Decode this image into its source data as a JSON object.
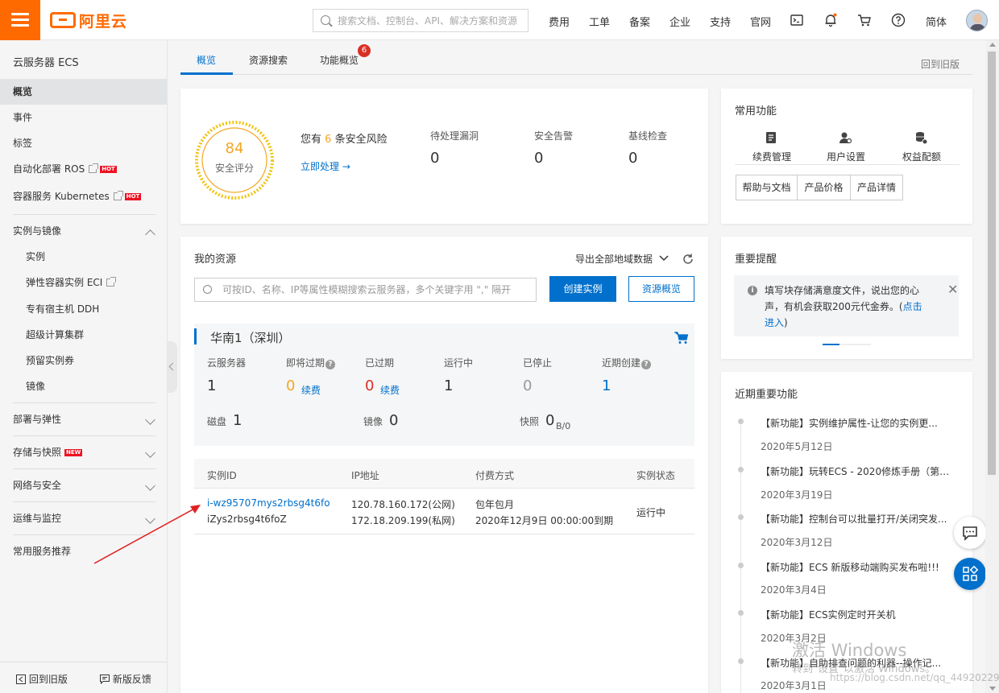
{
  "header": {
    "logo_text": "阿里云",
    "search_placeholder": "搜索文档、控制台、API、解决方案和资源",
    "nav": [
      "费用",
      "工单",
      "备案",
      "企业",
      "支持",
      "官网"
    ],
    "lang": "简体",
    "icons": [
      "terminal-icon",
      "bell-icon",
      "cart-icon",
      "help-icon"
    ]
  },
  "sidebar": {
    "title": "云服务器 ECS",
    "items": [
      {
        "label": "概览"
      },
      {
        "label": "事件"
      },
      {
        "label": "标签"
      },
      {
        "label": "自动化部署 ROS",
        "badge": "HOT"
      },
      {
        "label": "容器服务 Kubernetes",
        "badge": "HOT"
      }
    ],
    "group_instance": {
      "label": "实例与镜像",
      "children": [
        "实例",
        "弹性容器实例 ECI",
        "专有宿主机 DDH",
        "超级计算集群",
        "预留实例券",
        "镜像"
      ]
    },
    "groups": [
      {
        "label": "部署与弹性"
      },
      {
        "label": "存储与快照",
        "badge": "NEW"
      },
      {
        "label": "网络与安全"
      },
      {
        "label": "运维与监控"
      }
    ],
    "common": "常用服务推荐",
    "footer": {
      "old": "回到旧版",
      "feedback": "新版反馈"
    }
  },
  "tabs": {
    "items": [
      "概览",
      "资源搜索",
      "功能概览"
    ],
    "badge": "6",
    "back_old": "回到旧版"
  },
  "security": {
    "score": "84",
    "score_label": "安全评分",
    "risk_prefix": "您有",
    "risk_count": "6",
    "risk_suffix": "条安全风险",
    "action": "立即处理 →",
    "stats": [
      {
        "label": "待处理漏洞",
        "value": "0"
      },
      {
        "label": "安全告警",
        "value": "0"
      },
      {
        "label": "基线检查",
        "value": "0"
      }
    ]
  },
  "common_functions": {
    "title": "常用功能",
    "items": [
      "续费管理",
      "用户设置",
      "权益配额"
    ],
    "buttons": [
      "帮助与文档",
      "产品价格",
      "产品详情"
    ]
  },
  "resources": {
    "title": "我的资源",
    "export": "导出全部地域数据",
    "search_placeholder": "可按ID、名称、IP等属性模糊搜索云服务器，多个关键字用 \",\" 隔开",
    "create_btn": "创建实例",
    "overview_btn": "资源概览",
    "region": "华南1（深圳）",
    "stats": {
      "servers": {
        "label": "云服务器",
        "value": "1"
      },
      "expiring": {
        "label": "即将过期",
        "value": "0",
        "link": "续费"
      },
      "expired": {
        "label": "已过期",
        "value": "0",
        "link": "续费"
      },
      "running": {
        "label": "运行中",
        "value": "1"
      },
      "stopped": {
        "label": "已停止",
        "value": "0"
      },
      "recent": {
        "label": "近期创建",
        "value": "1"
      },
      "disk": {
        "label": "磁盘",
        "value": "1"
      },
      "image": {
        "label": "镜像",
        "value": "0"
      },
      "snapshot": {
        "label": "快照",
        "value": "0",
        "unit": "B/0"
      }
    },
    "table": {
      "headers": [
        "实例ID",
        "IP地址",
        "付费方式",
        "实例状态"
      ],
      "row": {
        "id": "i-wz95707mys2rbsg4t6fo",
        "name": "iZys2rbsg4t6foZ",
        "ip_public": "120.78.160.172(公网)",
        "ip_private": "172.18.209.199(私网)",
        "billing": "包年包月",
        "expire": "2020年12月9日 00:00:00到期",
        "status": "运行中"
      }
    }
  },
  "reminder": {
    "title": "重要提醒",
    "text": "填写块存储满意度文件，说出您的心声，有机会获取200元代金券。(",
    "link": "点击进入",
    "text_end": ")"
  },
  "recent_features": {
    "title": "近期重要功能",
    "items": [
      {
        "title": "【新功能】实例维护属性-让您的实例更...",
        "date": "2020年5月12日"
      },
      {
        "title": "【新功能】玩转ECS - 2020修炼手册（第1...",
        "date": "2020年3月19日"
      },
      {
        "title": "【新功能】控制台可以批量打开/关闭突发...",
        "date": "2020年3月12日"
      },
      {
        "title": "【新功能】ECS 新版移动端购买发布啦!!!",
        "date": "2020年3月4日"
      },
      {
        "title": "【新功能】ECS实例定时开关机",
        "date": "2020年3月2日"
      },
      {
        "title": "【新功能】自助排查问题的利器--操作记...",
        "date": "2020年3月1日"
      }
    ]
  },
  "watermark": {
    "line1": "激活 Windows",
    "line2": "转到\"设置\"以激活 Windows。",
    "line3": "https://blog.csdn.net/qq_44920229"
  },
  "colors": {
    "brand": "#ff6a00",
    "primary": "#0070cc",
    "warning": "#f5a623",
    "danger": "#d93026",
    "arrow": "#e02020"
  }
}
